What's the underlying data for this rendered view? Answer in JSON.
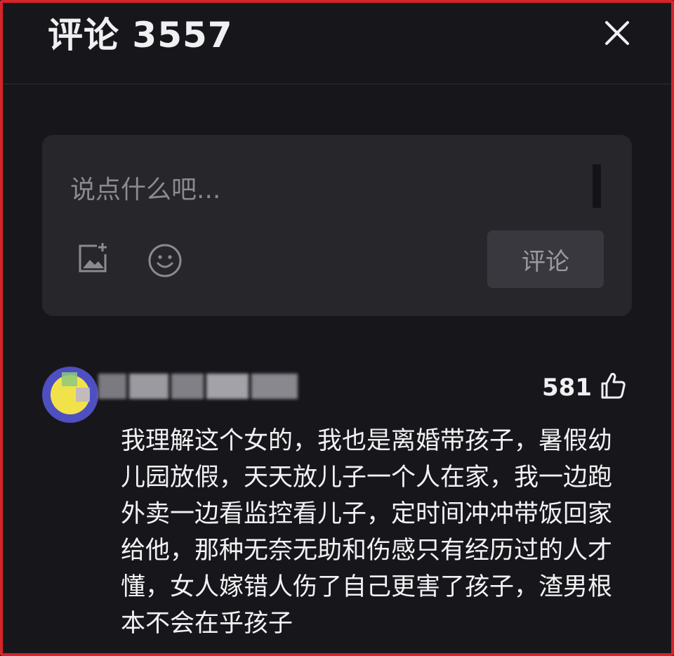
{
  "header": {
    "title": "评论 3557"
  },
  "composer": {
    "placeholder": "说点什么吧...",
    "value": "",
    "submit_label": "评论",
    "icons": [
      "add-image-icon",
      "emoji-icon"
    ]
  },
  "comment": {
    "like_count": "581",
    "text": "我理解这个女的，我也是离婚带孩子，暑假幼儿园放假，天天放儿子一个人在家，我一边跑外卖一边看监控看儿子，定时间冲冲带饭回家给他，那种无奈无助和伤感只有经历过的人才懂，女人嫁错人伤了自己更害了孩子，渣男根本不会在乎孩子",
    "icons": [
      "thumbs-up-icon"
    ]
  },
  "colors": {
    "background": "#17171b",
    "panel": "#26262b",
    "border_highlight": "#d8232a",
    "avatar_ring": "#4e4fc0",
    "avatar_fill": "#f1e24a"
  }
}
